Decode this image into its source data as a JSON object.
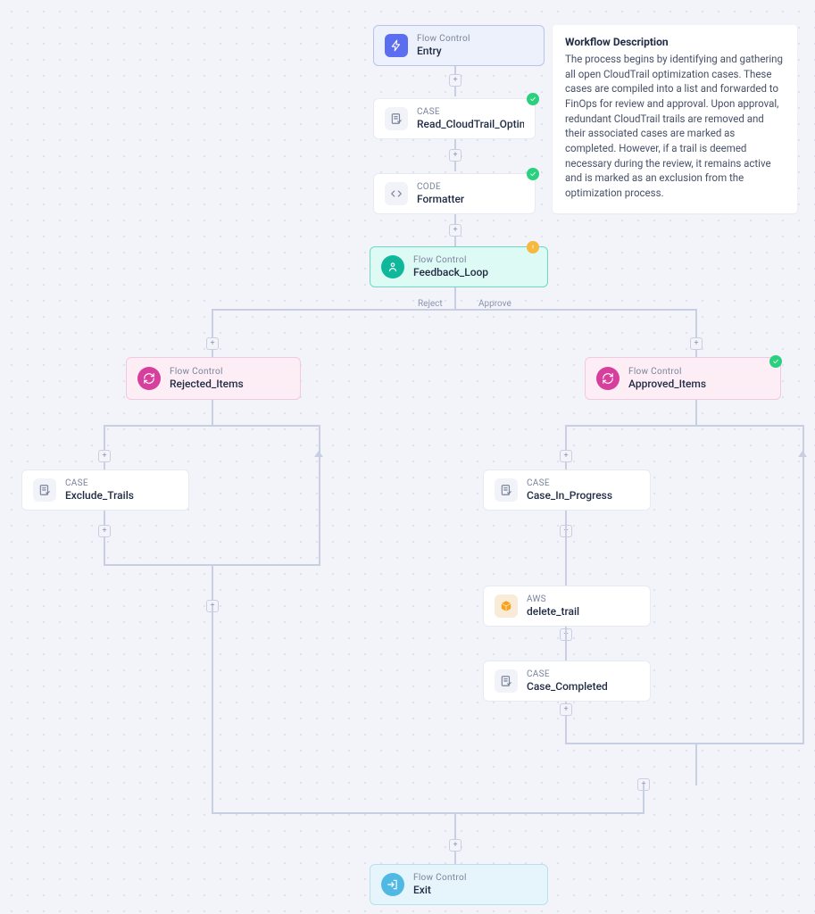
{
  "description": {
    "title": "Workflow Description",
    "body": "The process begins by identifying and gathering all open CloudTrail optimization cases. These cases are compiled into a list and forwarded to FinOps for review and approval. Upon approval, redundant CloudTrail trails are removed and their associated cases are marked as completed. However, if a trail is deemed necessary during the review, it remains active and is marked as an exclusion from the optimization process."
  },
  "nodes": {
    "entry": {
      "kind": "Flow Control",
      "name": "Entry"
    },
    "read_case": {
      "kind": "CASE",
      "name": "Read_CloudTrail_Optimization"
    },
    "formatter": {
      "kind": "CODE",
      "name": "Formatter"
    },
    "feedback": {
      "kind": "Flow Control",
      "name": "Feedback_Loop"
    },
    "rejected": {
      "kind": "Flow Control",
      "name": "Rejected_Items"
    },
    "approved": {
      "kind": "Flow Control",
      "name": "Approved_Items"
    },
    "exclude": {
      "kind": "CASE",
      "name": "Exclude_Trails"
    },
    "inprogress": {
      "kind": "CASE",
      "name": "Case_In_Progress"
    },
    "delete_trail": {
      "kind": "AWS",
      "name": "delete_trail"
    },
    "completed": {
      "kind": "CASE",
      "name": "Case_Completed"
    },
    "exit": {
      "kind": "Flow Control",
      "name": "Exit"
    }
  },
  "branch_labels": {
    "reject": "Reject",
    "approve": "Approve"
  }
}
